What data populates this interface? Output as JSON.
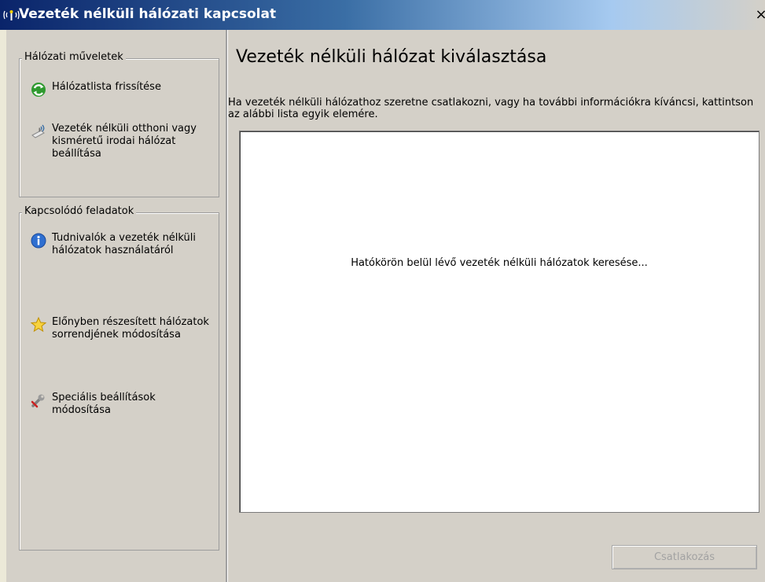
{
  "window": {
    "title": "Vezeték nélküli hálózati kapcsolat",
    "close_glyph": "×"
  },
  "network_tasks": {
    "legend": "Hálózati műveletek",
    "items": [
      {
        "label": "Hálózatlista frissítése",
        "icon": "refresh-icon"
      },
      {
        "label": "Vezeték nélküli otthoni vagy kisméretű irodai hálózat beállítása",
        "icon": "wireless-setup-icon"
      }
    ]
  },
  "related_tasks": {
    "legend": "Kapcsolódó feladatok",
    "items": [
      {
        "label": "Tudnivalók a vezeték nélküli hálózatok használatáról",
        "icon": "info-icon"
      },
      {
        "label": "Előnyben részesített hálózatok sorrendjének módosítása",
        "icon": "star-icon"
      },
      {
        "label": "Speciális beállítások módosítása",
        "icon": "wrench-icon"
      }
    ]
  },
  "main": {
    "heading": "Vezeték nélküli hálózat kiválasztása",
    "instructions": "Ha vezeték nélküli hálózathoz szeretne csatlakozni, vagy ha további információkra kíváncsi, kattintson az alábbi lista egyik elemére.",
    "searching_text": "Hatókörön belül lévő vezeték nélküli hálózatok keresése...",
    "connect_label": "Csatlakozás"
  },
  "colors": {
    "title_start": "#0a246a",
    "title_end": "#a6caf0",
    "pane_background": "#d4d0c8",
    "disabled_text": "#a2a2a2"
  }
}
